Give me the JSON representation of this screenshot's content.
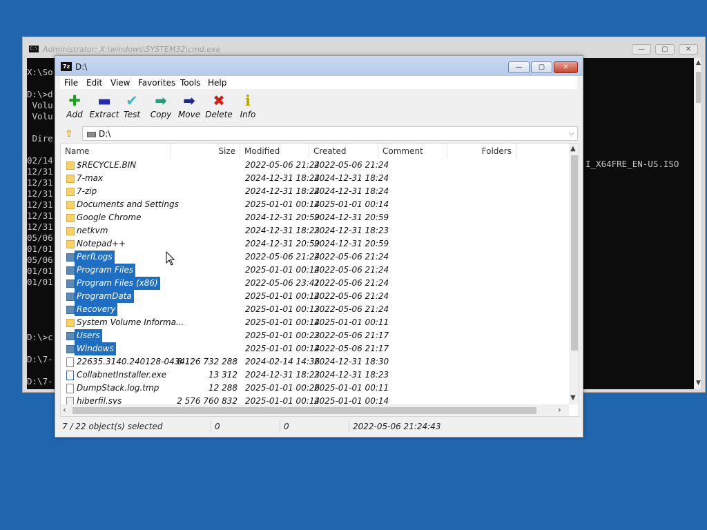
{
  "cmd": {
    "title": "Administrator: X:\\windows\\SYSTEM32\\cmd.exe",
    "minimize": "—",
    "maximize": "▢",
    "close": "✕",
    "lines": [
      "X:\\So",
      "",
      "D:\\>d",
      " Volu",
      " Volu",
      "",
      " Dire",
      "",
      "02/14",
      "12/31",
      "12/31",
      "12/31",
      "12/31",
      "12/31",
      "12/31",
      "05/06",
      "01/01",
      "05/06",
      "01/01",
      "01/01",
      "",
      "",
      "",
      "",
      "D:\\>c",
      "",
      "D:\\7-",
      "",
      "D:\\7-"
    ],
    "right_text": "I_X64FRE_EN-US.ISO"
  },
  "fm": {
    "app_icon": "7z",
    "title": "D:\\",
    "minimize": "—",
    "maximize": "▢",
    "close": "✕",
    "menu": [
      "File",
      "Edit",
      "View",
      "Favorites",
      "Tools",
      "Help"
    ],
    "toolbar": [
      {
        "label": "Add",
        "icon": "plus-icon",
        "glyph": "✚",
        "color": "#1ea01e"
      },
      {
        "label": "Extract",
        "icon": "minus-icon",
        "glyph": "▬",
        "color": "#2a2ab0"
      },
      {
        "label": "Test",
        "icon": "check-icon",
        "glyph": "✔",
        "color": "#3fb8c8"
      },
      {
        "label": "Copy",
        "icon": "copy-arrow-icon",
        "glyph": "➡",
        "color": "#2a9a7a"
      },
      {
        "label": "Move",
        "icon": "move-arrow-icon",
        "glyph": "➡",
        "color": "#1c2a8a"
      },
      {
        "label": "Delete",
        "icon": "delete-x-icon",
        "glyph": "✖",
        "color": "#d21b1b"
      },
      {
        "label": "Info",
        "icon": "info-icon",
        "glyph": "ℹ",
        "color": "#b8a800"
      }
    ],
    "address": "D:\\",
    "columns": [
      "Name",
      "Size",
      "Modified",
      "Created",
      "Comment",
      "Folders"
    ],
    "rows": [
      {
        "name": "$RECYCLE.BIN",
        "size": "",
        "modified": "2022-05-06 21:24",
        "created": "2022-05-06 21:24",
        "type": "folder",
        "selected": false
      },
      {
        "name": "7-max",
        "size": "",
        "modified": "2024-12-31 18:24",
        "created": "2024-12-31 18:24",
        "type": "folder",
        "selected": false
      },
      {
        "name": "7-zip",
        "size": "",
        "modified": "2024-12-31 18:24",
        "created": "2024-12-31 18:24",
        "type": "folder",
        "selected": false
      },
      {
        "name": "Documents and Settings",
        "size": "",
        "modified": "2025-01-01 00:14",
        "created": "2025-01-01 00:14",
        "type": "folder",
        "selected": false
      },
      {
        "name": "Google Chrome",
        "size": "",
        "modified": "2024-12-31 20:59",
        "created": "2024-12-31 20:59",
        "type": "folder",
        "selected": false
      },
      {
        "name": "netkvm",
        "size": "",
        "modified": "2024-12-31 18:23",
        "created": "2024-12-31 18:23",
        "type": "folder",
        "selected": false
      },
      {
        "name": "Notepad++",
        "size": "",
        "modified": "2024-12-31 20:59",
        "created": "2024-12-31 20:59",
        "type": "folder",
        "selected": false
      },
      {
        "name": "PerfLogs",
        "size": "",
        "modified": "2022-05-06 21:24",
        "created": "2022-05-06 21:24",
        "type": "folder",
        "selected": true
      },
      {
        "name": "Program Files",
        "size": "",
        "modified": "2025-01-01 00:14",
        "created": "2022-05-06 21:24",
        "type": "folder",
        "selected": true
      },
      {
        "name": "Program Files (x86)",
        "size": "",
        "modified": "2022-05-06 23:41",
        "created": "2022-05-06 21:24",
        "type": "folder",
        "selected": true
      },
      {
        "name": "ProgramData",
        "size": "",
        "modified": "2025-01-01 00:14",
        "created": "2022-05-06 21:24",
        "type": "folder",
        "selected": true
      },
      {
        "name": "Recovery",
        "size": "",
        "modified": "2025-01-01 00:13",
        "created": "2022-05-06 21:24",
        "type": "folder",
        "selected": true
      },
      {
        "name": "System Volume Informa...",
        "size": "",
        "modified": "2025-01-01 00:14",
        "created": "2025-01-01 00:11",
        "type": "folder",
        "selected": false
      },
      {
        "name": "Users",
        "size": "",
        "modified": "2025-01-01 00:23",
        "created": "2022-05-06 21:17",
        "type": "folder",
        "selected": true
      },
      {
        "name": "Windows",
        "size": "",
        "modified": "2025-01-01 00:14",
        "created": "2022-05-06 21:17",
        "type": "folder",
        "selected": true
      },
      {
        "name": "22635.3140.240128-0434...",
        "size": "8 126 732 288",
        "modified": "2024-02-14 14:36",
        "created": "2024-12-31 18:30",
        "type": "file",
        "selected": false
      },
      {
        "name": "CollabnetInstaller.exe",
        "size": "13 312",
        "modified": "2024-12-31 18:23",
        "created": "2024-12-31 18:23",
        "type": "exe",
        "selected": false
      },
      {
        "name": "DumpStack.log.tmp",
        "size": "12 288",
        "modified": "2025-01-01 00:26",
        "created": "2025-01-01 00:11",
        "type": "file",
        "selected": false
      },
      {
        "name": "hiberfil.sys",
        "size": "2 576 760 832",
        "modified": "2025-01-01 00:14",
        "created": "2025-01-01 00:14",
        "type": "sys",
        "selected": false
      }
    ],
    "status": {
      "selection": "7 / 22 object(s) selected",
      "size": "0",
      "packed": "0",
      "date": "2022-05-06 21:24:43"
    }
  },
  "colors": {
    "desktop": "#1f66ae",
    "selection": "#1e6fc4"
  }
}
